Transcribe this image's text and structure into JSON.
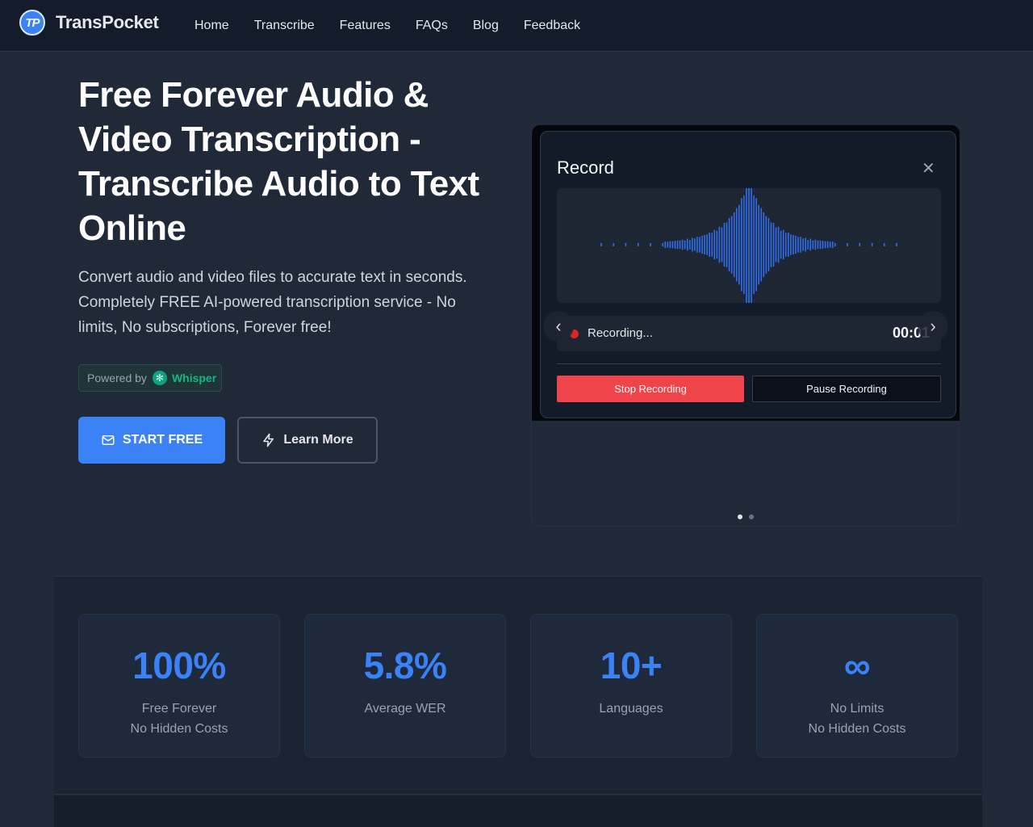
{
  "nav": {
    "logo_badge": "TP",
    "brand": "TransPocket",
    "links": [
      "Home",
      "Transcribe",
      "Features",
      "FAQs",
      "Blog",
      "Feedback"
    ]
  },
  "hero": {
    "title": "Free Forever Audio & Video Transcription - Transcribe Audio to Text Online",
    "subtitle": "Convert audio and video files to accurate text in seconds. Completely FREE AI-powered transcription service - No limits, No subscriptions, Forever free!",
    "powered_prefix": "Powered by",
    "powered_brand": "Whisper",
    "start_button": "START FREE",
    "learn_button": "Learn More"
  },
  "recorder": {
    "title": "Record",
    "status": "Recording...",
    "timer": "00:01",
    "stop_label": "Stop Recording",
    "pause_label": "Pause Recording",
    "prev_glyph": "‹",
    "next_glyph": "›",
    "slide_count": 2,
    "active_slide": 1
  },
  "stats": [
    {
      "value": "100%",
      "line1": "Free Forever",
      "line2": "No Hidden Costs"
    },
    {
      "value": "5.8%",
      "line1": "Average WER",
      "line2": ""
    },
    {
      "value": "10+",
      "line1": "Languages",
      "line2": ""
    },
    {
      "value": "∞",
      "line1": "No Limits",
      "line2": "No Hidden Costs"
    }
  ],
  "colors": {
    "accent": "#3b82f6",
    "stop": "#f0444b",
    "whisper": "#10b981",
    "page_bg": "#1f2937",
    "nav_bg": "#141b2b"
  },
  "icons": {
    "start": "mail-icon",
    "learn": "lightning-icon",
    "close": "close-icon",
    "powered": "openai-icon"
  }
}
